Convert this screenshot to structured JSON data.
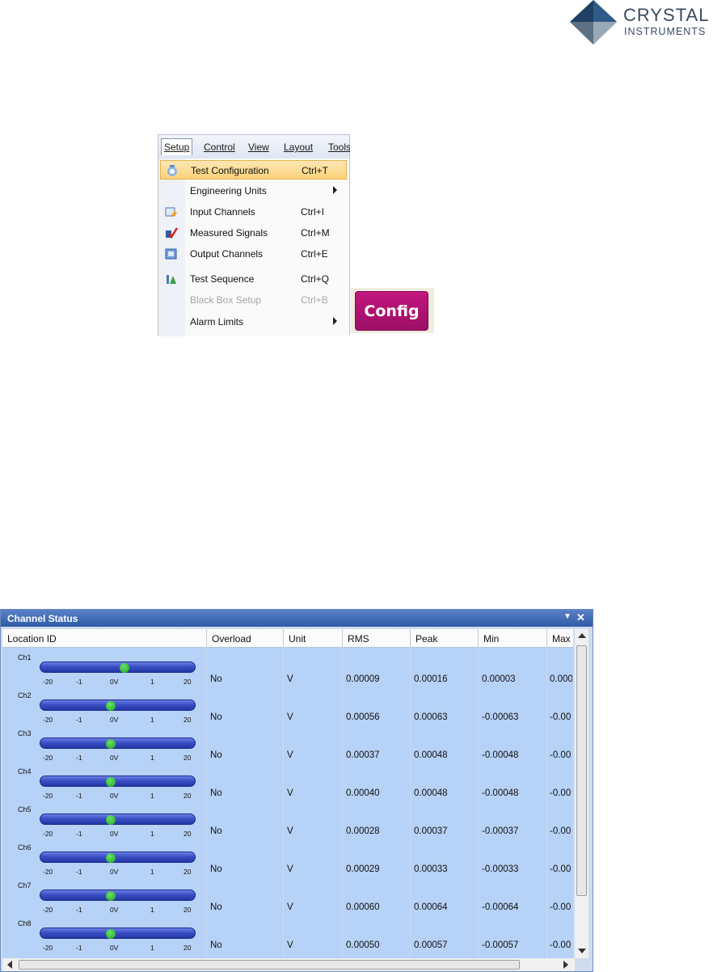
{
  "logo": {
    "name": "CRYSTAL",
    "sub": "INSTRUMENTS"
  },
  "menubar": [
    "Setup",
    "Control",
    "View",
    "Layout",
    "Tools"
  ],
  "menu_items": [
    {
      "label": "Test Configuration",
      "shortcut": "Ctrl+T",
      "icon": "test-configuration-icon",
      "highlighted": true
    },
    {
      "label": "Engineering Units",
      "shortcut": "",
      "submenu": true
    },
    {
      "label": "Input Channels",
      "shortcut": "Ctrl+I",
      "icon": "input-channels-icon"
    },
    {
      "label": "Measured Signals",
      "shortcut": "Ctrl+M",
      "icon": "measured-signals-icon"
    },
    {
      "label": "Output Channels",
      "shortcut": "Ctrl+E",
      "icon": "output-channels-icon"
    },
    {
      "label": "Test Sequence",
      "shortcut": "Ctrl+Q",
      "icon": "test-sequence-icon"
    },
    {
      "label": "Black Box Setup",
      "shortcut": "Ctrl+B",
      "disabled": true
    },
    {
      "label": "Alarm Limits",
      "shortcut": "",
      "submenu": true
    }
  ],
  "config_button": "Config",
  "panel": {
    "title": "Channel Status",
    "columns": [
      "Location ID",
      "Overload",
      "Unit",
      "RMS",
      "Peak",
      "Min",
      "Max"
    ],
    "ticks": [
      "-20",
      "-1",
      "0V",
      "1",
      "20"
    ],
    "rows": [
      {
        "ch": "Ch1",
        "level": 0.55,
        "overload": "No",
        "unit": "V",
        "rms": "0.00009",
        "peak": "0.00016",
        "min": "0.00003",
        "max": "0.000"
      },
      {
        "ch": "Ch2",
        "level": 0.45,
        "overload": "No",
        "unit": "V",
        "rms": "0.00056",
        "peak": "0.00063",
        "min": "-0.00063",
        "max": "-0.00"
      },
      {
        "ch": "Ch3",
        "level": 0.45,
        "overload": "No",
        "unit": "V",
        "rms": "0.00037",
        "peak": "0.00048",
        "min": "-0.00048",
        "max": "-0.00"
      },
      {
        "ch": "Ch4",
        "level": 0.45,
        "overload": "No",
        "unit": "V",
        "rms": "0.00040",
        "peak": "0.00048",
        "min": "-0.00048",
        "max": "-0.00"
      },
      {
        "ch": "Ch5",
        "level": 0.45,
        "overload": "No",
        "unit": "V",
        "rms": "0.00028",
        "peak": "0.00037",
        "min": "-0.00037",
        "max": "-0.00"
      },
      {
        "ch": "Ch6",
        "level": 0.45,
        "overload": "No",
        "unit": "V",
        "rms": "0.00029",
        "peak": "0.00033",
        "min": "-0.00033",
        "max": "-0.00"
      },
      {
        "ch": "Ch7",
        "level": 0.45,
        "overload": "No",
        "unit": "V",
        "rms": "0.00060",
        "peak": "0.00064",
        "min": "-0.00064",
        "max": "-0.00"
      },
      {
        "ch": "Ch8",
        "level": 0.45,
        "overload": "No",
        "unit": "V",
        "rms": "0.00050",
        "peak": "0.00057",
        "min": "-0.00057",
        "max": "-0.00"
      }
    ]
  }
}
